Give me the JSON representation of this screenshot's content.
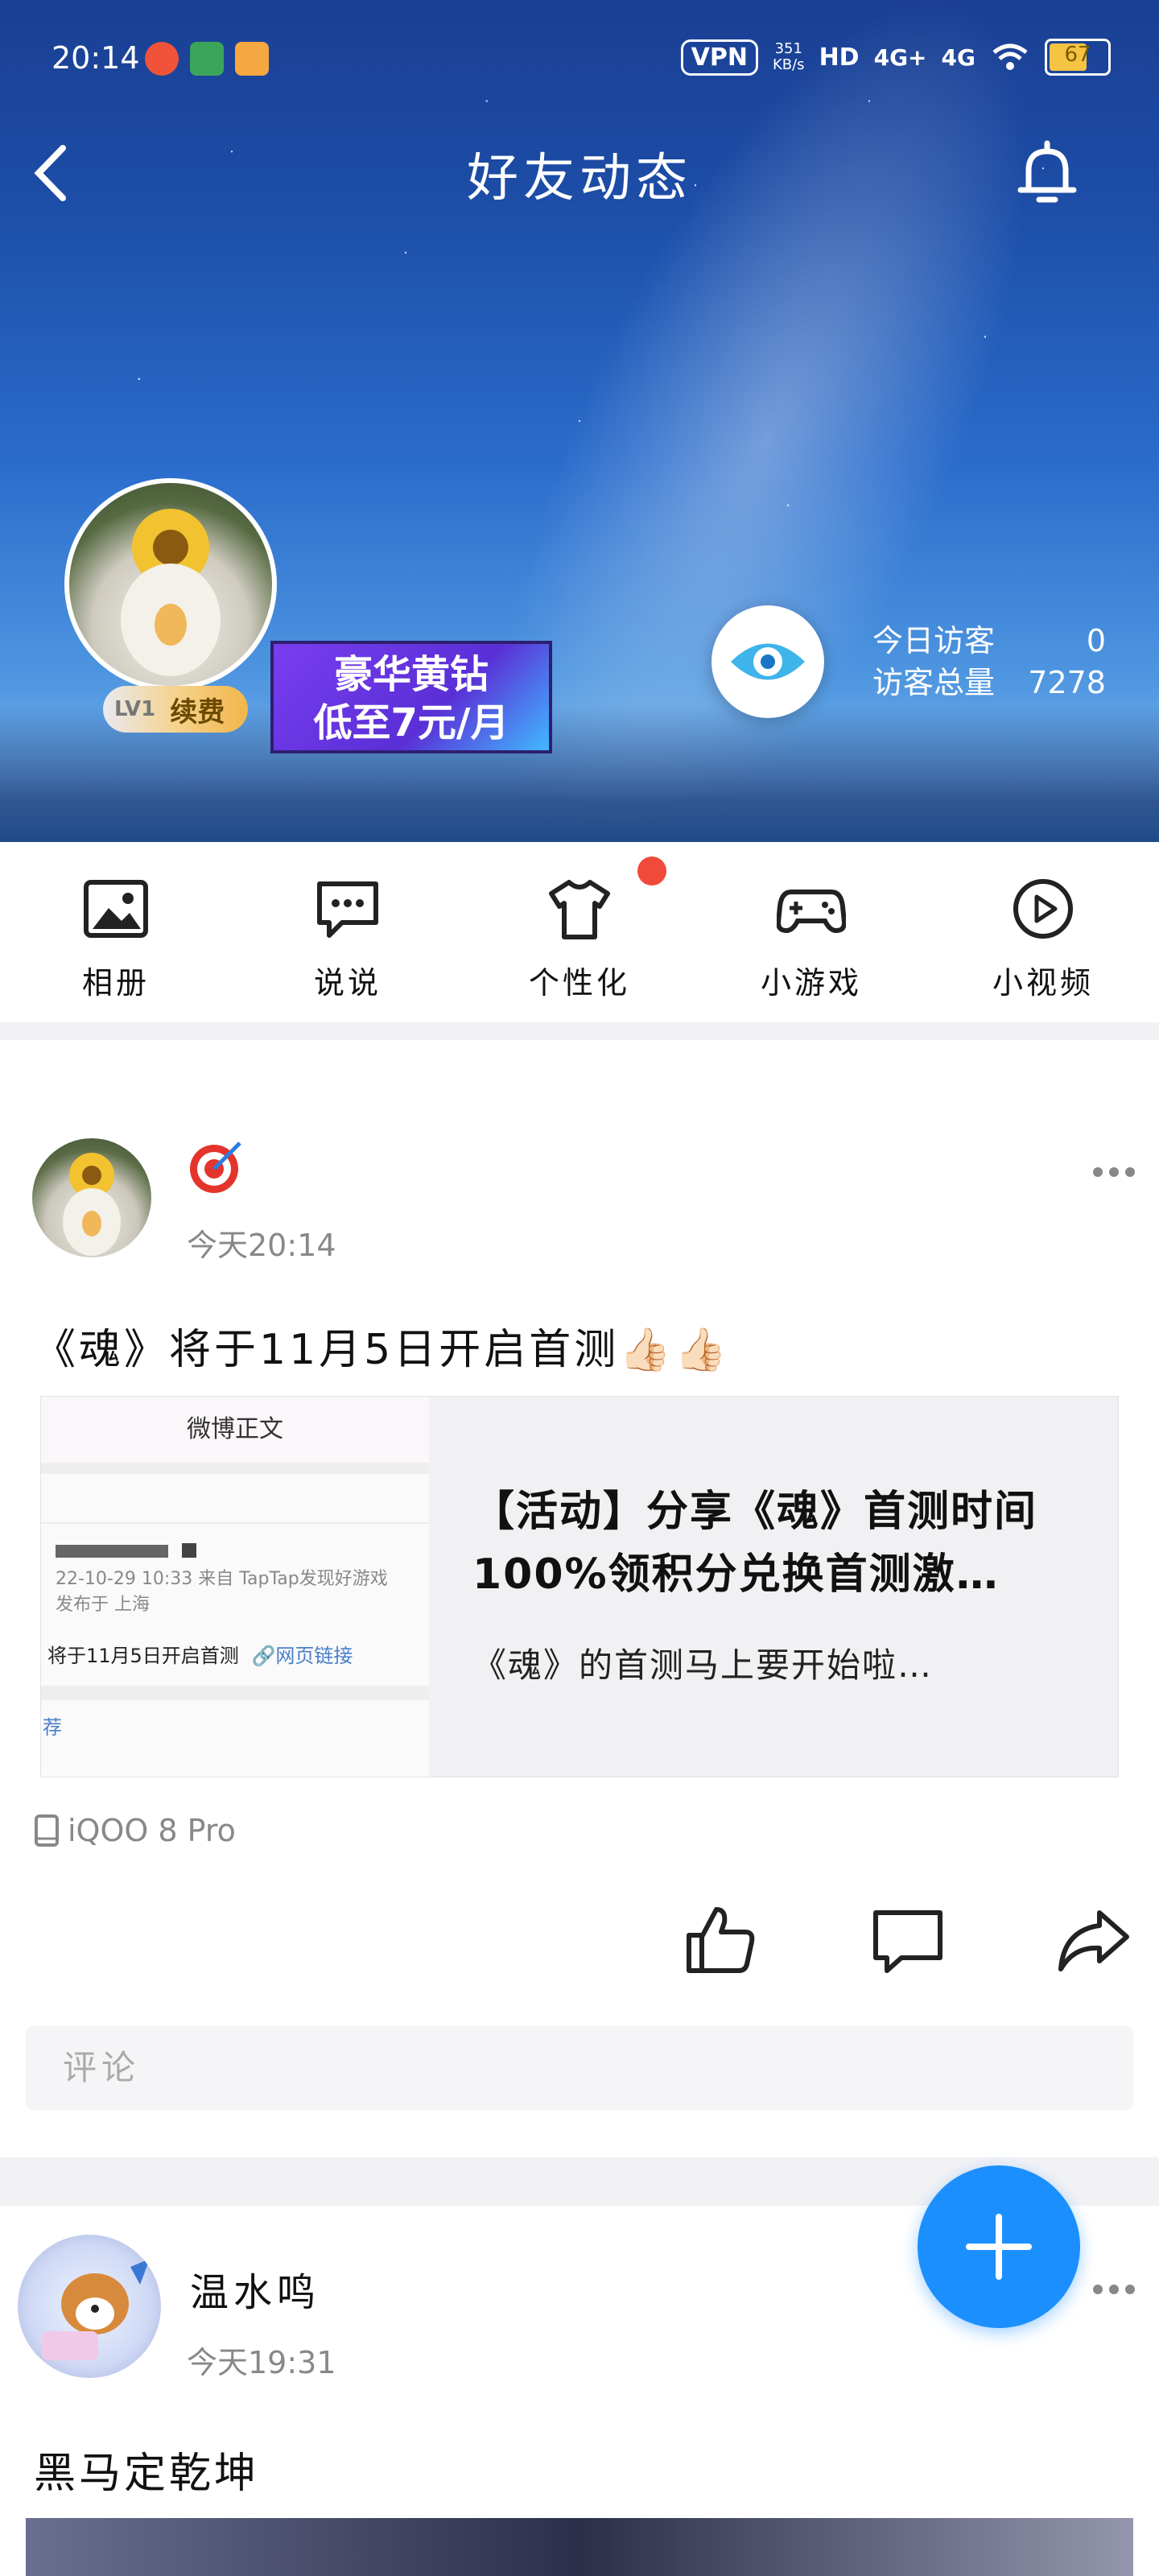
{
  "status_bar": {
    "time": "20:14",
    "vpn": "VPN",
    "speed_value": "351",
    "speed_unit": "KB/s",
    "hd": "HD",
    "net1": "4G+",
    "net2": "4G",
    "battery": "67"
  },
  "header": {
    "title": "好友动态",
    "back_icon": "back-chevron-icon",
    "bell_icon": "bell-icon",
    "level": "LV1",
    "renew": "续费",
    "vip_line1": "豪华黄钻",
    "vip_line2": "低至7元/月",
    "visitors_today_label": "今日访客",
    "visitors_today_value": "0",
    "visitors_total_label": "访客总量",
    "visitors_total_value": "7278"
  },
  "quick_entries": [
    {
      "label": "相册",
      "icon": "photo-album-icon"
    },
    {
      "label": "说说",
      "icon": "message-bubble-icon"
    },
    {
      "label": "个性化",
      "icon": "tshirt-icon"
    },
    {
      "label": "小游戏",
      "icon": "gamepad-icon"
    },
    {
      "label": "小视频",
      "icon": "play-circle-icon"
    }
  ],
  "post1": {
    "name_icon": "target-emoji-icon",
    "time": "今天20:14",
    "text": "《魂》将于11月5日开启首测👍🏻👍🏻",
    "card": {
      "thumb_header": "微博正文",
      "thumb_meta1": "22-10-29 10:33  来自 TapTap发现好游戏",
      "thumb_meta2": "发布于 上海",
      "thumb_body": "将于11月5日开启首测",
      "thumb_link": "🔗网页链接",
      "thumb_tag": "荐",
      "title": "【活动】分享《魂》首测时间100%领积分兑换首测激…",
      "desc": "《魂》的首测马上要开始啦…"
    },
    "device": "iQOO 8 Pro",
    "comment_placeholder": "评论"
  },
  "post2": {
    "name": "温水鸣",
    "time": "今天19:31",
    "text": "黑马定乾坤"
  },
  "fab_icon": "plus-icon",
  "colors": {
    "accent": "#1c8fff",
    "red_dot": "#f04a3a"
  }
}
